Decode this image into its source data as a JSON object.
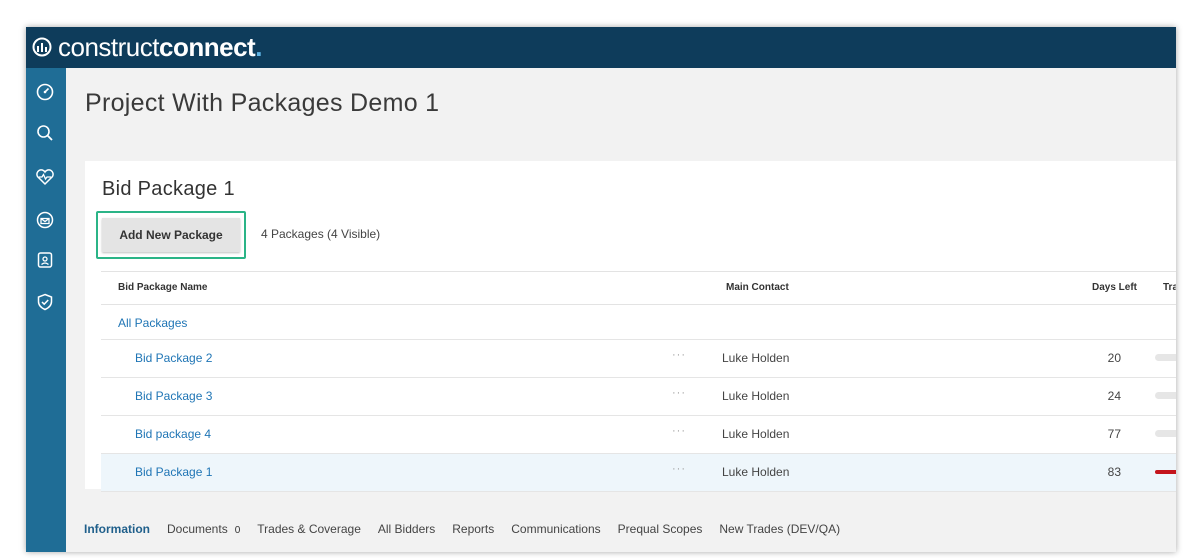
{
  "app": {
    "brand_light": "construct",
    "brand_bold": "connect",
    "brand_dot": "."
  },
  "sidebar": {
    "icons": [
      "dashboard-icon",
      "search-icon",
      "heart-pulse-icon",
      "mail-open-icon",
      "contacts-icon",
      "shield-check-icon"
    ]
  },
  "page": {
    "title": "Project With Packages Demo 1"
  },
  "card": {
    "title": "Bid Package 1",
    "add_button_label": "Add New Package",
    "package_count": "4 Packages (4 Visible)"
  },
  "table": {
    "columns": {
      "name": "Bid Package Name",
      "contact": "Main Contact",
      "days": "Days Left",
      "trades": "Tra"
    },
    "all_label": "All Packages",
    "rows": [
      {
        "name": "Bid Package 2",
        "menu": "···",
        "contact": "Luke Holden",
        "days": "20"
      },
      {
        "name": "Bid Package 3",
        "menu": "···",
        "contact": "Luke Holden",
        "days": "24"
      },
      {
        "name": "Bid package 4",
        "menu": "···",
        "contact": "Luke Holden",
        "days": "77"
      },
      {
        "name": "Bid Package 1",
        "menu": "···",
        "contact": "Luke Holden",
        "days": "83"
      }
    ]
  },
  "tabs": {
    "information": "Information",
    "documents": "Documents",
    "documents_count": "0",
    "trades": "Trades & Coverage",
    "bidders": "All Bidders",
    "reports": "Reports",
    "communications": "Communications",
    "prequal": "Prequal Scopes",
    "new_trades": "New Trades (DEV/QA)"
  },
  "colors": {
    "topbar": "#0e3c5b",
    "sidebar": "#1f6d96",
    "link": "#1f75b5",
    "highlight": "#2bb487",
    "trade_active": "#c4141b"
  }
}
